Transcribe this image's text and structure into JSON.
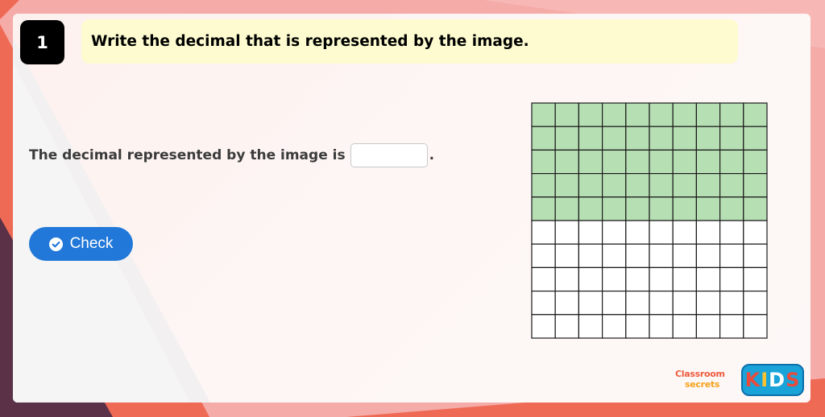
{
  "question": {
    "number": "1",
    "prompt": "Write the decimal that is represented by the image."
  },
  "answer": {
    "sentence": "The decimal represented by the image is",
    "input_value": "",
    "input_placeholder": "",
    "suffix": "."
  },
  "check_button": {
    "label": "Check",
    "icon": "check-circle-icon"
  },
  "hundred_square": {
    "columns": 10,
    "rows": 10,
    "shaded_rows": 5,
    "shaded_color": "#b7dfb4",
    "unshaded_color": "#ffffff",
    "line_color": "#1a1a1a"
  },
  "logo": {
    "line1": "Classroom",
    "line2": "secrets",
    "badge": [
      "K",
      "I",
      "D",
      "S"
    ],
    "badge_colors": [
      "#e94b3c",
      "#f9c22e",
      "#ffffff",
      "#e94b3c"
    ]
  },
  "colors": {
    "background": "#f5aba8",
    "accent_coral": "#ee6a55",
    "accent_dark": "#5a3147",
    "prompt_bg": "#fdfbcf",
    "button_blue": "#2178d9"
  }
}
